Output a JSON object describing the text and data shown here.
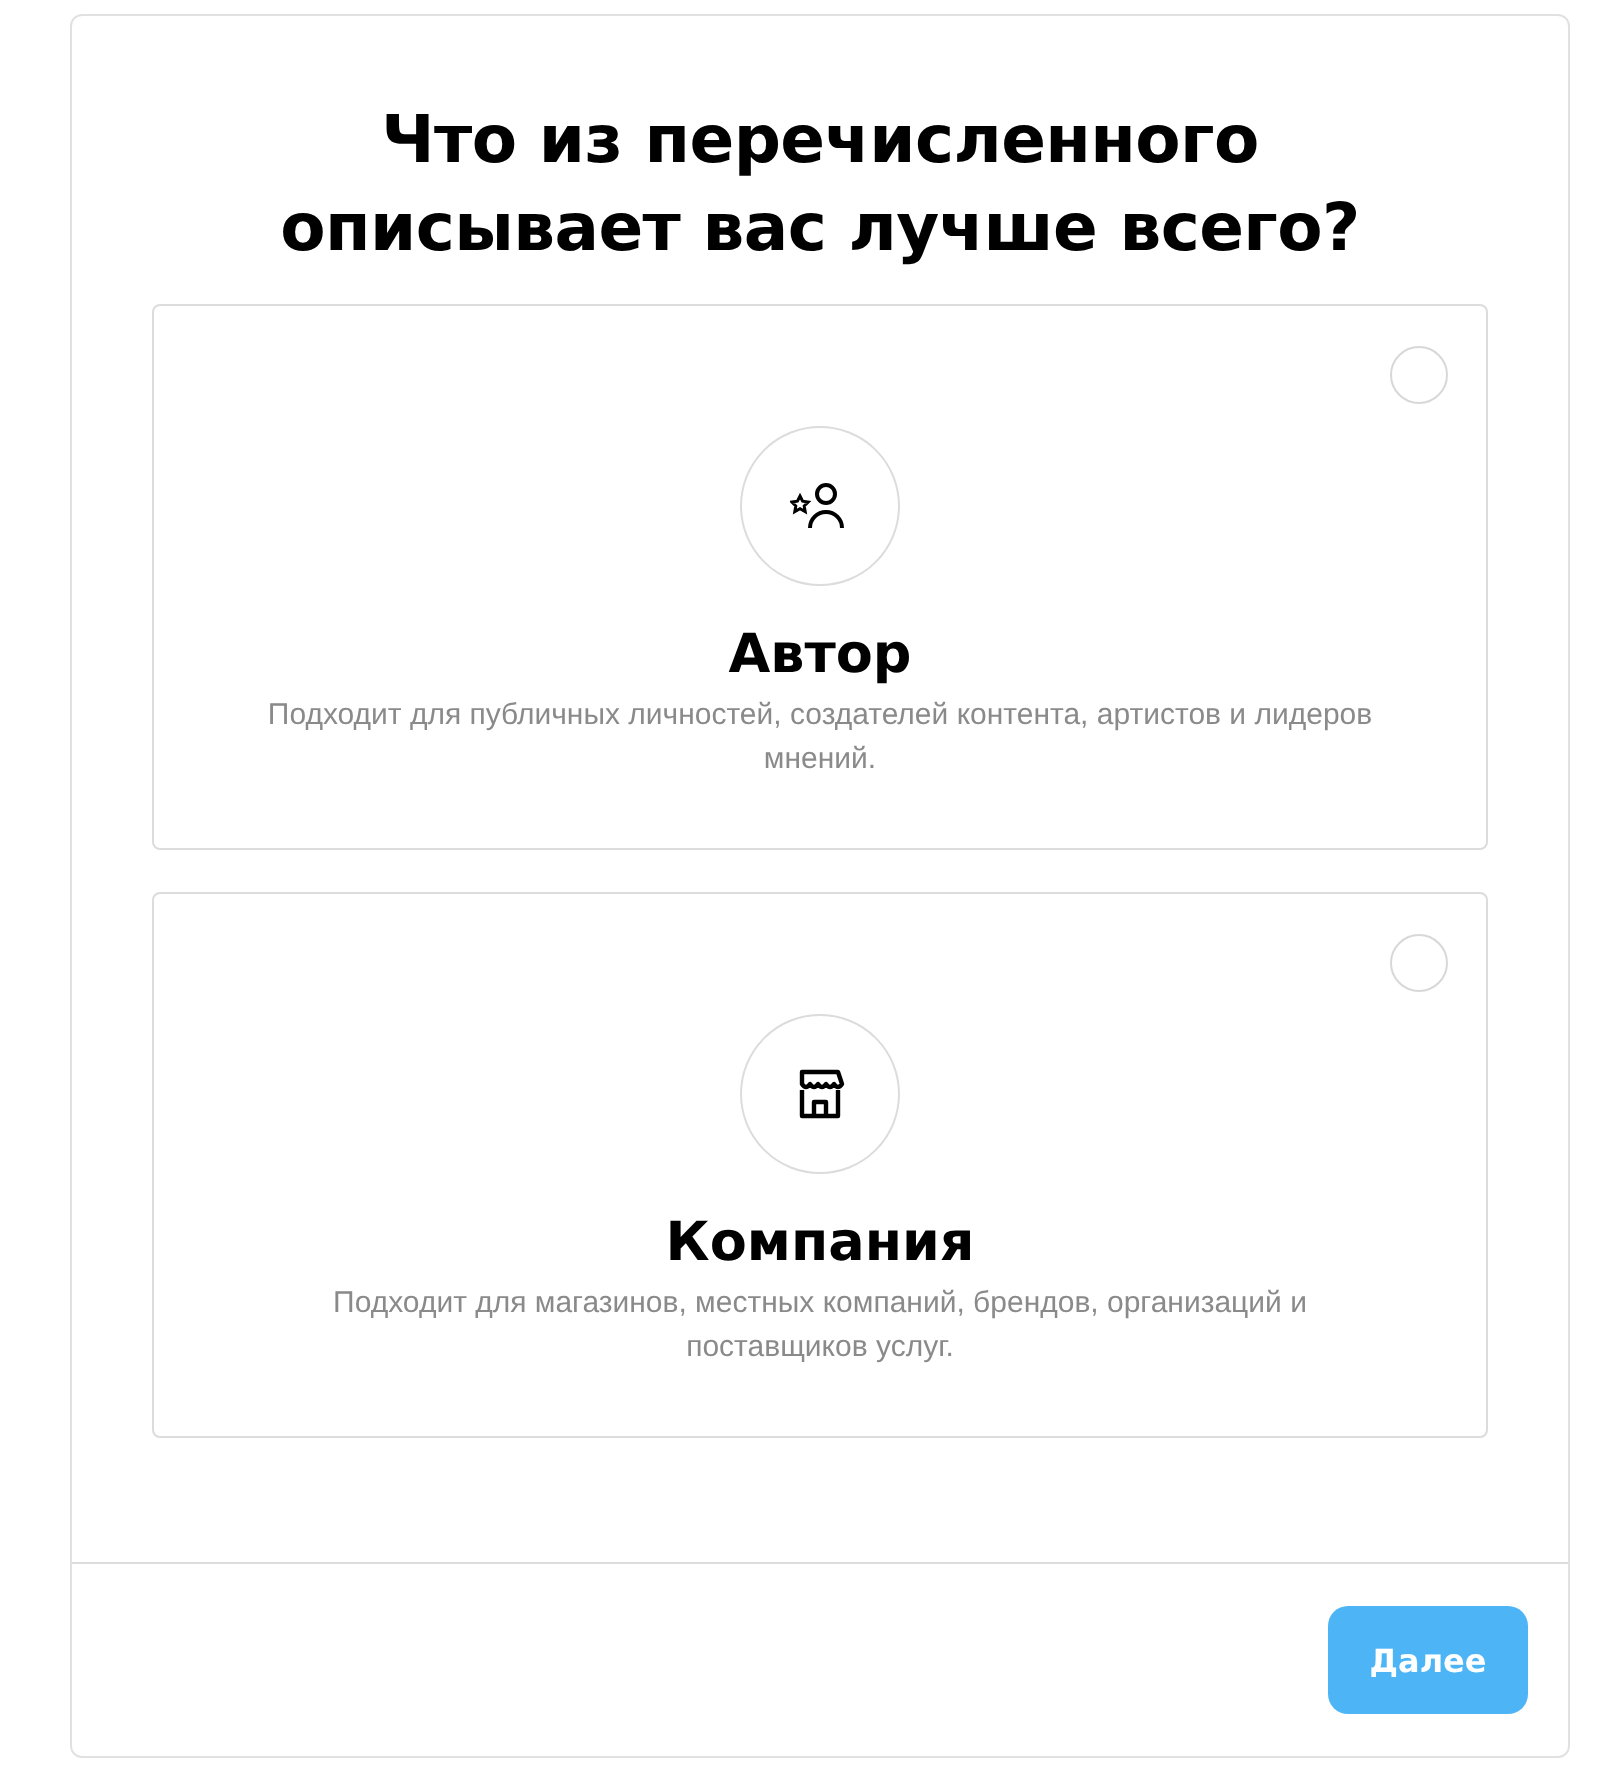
{
  "title": "Что из перечисленного описывает вас лучше всего?",
  "options": [
    {
      "kind": "creator",
      "label": "Автор",
      "description": "Подходит для публичных личностей, создателей контента, артистов и лидеров мнений.",
      "selected": false
    },
    {
      "kind": "business",
      "label": "Компания",
      "description": "Подходит для магазинов, местных компаний, брендов, организаций и поставщиков услуг.",
      "selected": false
    }
  ],
  "next_button": {
    "label": "Далее",
    "disabled": true
  }
}
